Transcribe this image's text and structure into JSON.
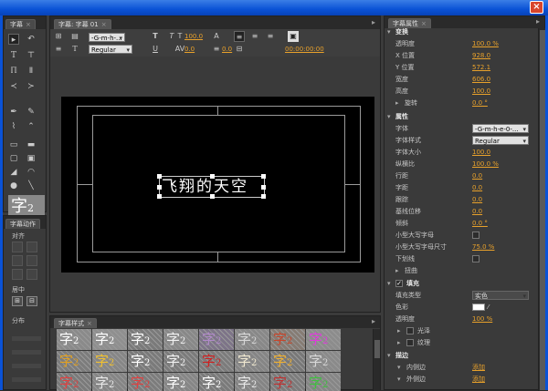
{
  "window": {
    "close_glyph": "×"
  },
  "tools_panel": {
    "tab": "字幕"
  },
  "align_panel": {
    "tab": "字幕动作",
    "align_label": "对齐",
    "center_label": "居中",
    "distribute_label": "分布"
  },
  "title_panel": {
    "tab": "字幕: 字幕 01",
    "font_select": "-G-m-h-...",
    "style_select": "Regular",
    "size_value": "100.0",
    "kerning_value": "0.0",
    "leading_value": "0.0",
    "timecode": "00:00:00:00",
    "canvas_text": "飞翔的天空"
  },
  "styles_panel": {
    "tab": "字幕样式",
    "swatch_glyph": "字",
    "swatch_suffix": "2",
    "swatches": [
      {
        "bg": "#8a8a8a",
        "fg": "#ffffff"
      },
      {
        "bg": "#8f8f8f",
        "fg": "#ffffff"
      },
      {
        "bg": "#7a7a7a",
        "fg": "#ffffff"
      },
      {
        "bg": "#888888",
        "fg": "#f2f2f2"
      },
      {
        "bg": "#7d7488",
        "fg": "#b08ac8"
      },
      {
        "bg": "#888888",
        "fg": "#d8d8d8"
      },
      {
        "bg": "#867c74",
        "fg": "#c8452a"
      },
      {
        "bg": "#8c8c8c",
        "fg": "#e03adc"
      },
      {
        "bg": "#7c7c7c",
        "fg": "#e2a020"
      },
      {
        "bg": "#868686",
        "fg": "#f0c030"
      },
      {
        "bg": "#7a7a7a",
        "fg": "#ffffff"
      },
      {
        "bg": "#7b7b7b",
        "fg": "#f2f2f2"
      },
      {
        "bg": "#7c7c7c",
        "fg": "#d02020"
      },
      {
        "bg": "#858585",
        "fg": "#f0e8d0"
      },
      {
        "bg": "#787878",
        "fg": "#f0b030"
      },
      {
        "bg": "#8a8a8a",
        "fg": "#d8d8d8"
      },
      {
        "bg": "#7a7a7a",
        "fg": "#e04040"
      },
      {
        "bg": "#858585",
        "fg": "#e8e8e8"
      },
      {
        "bg": "#7c7c7c",
        "fg": "#e04040"
      },
      {
        "bg": "#868686",
        "fg": "#ffffff"
      },
      {
        "bg": "#7a7a7a",
        "fg": "#ffffff"
      },
      {
        "bg": "#848484",
        "fg": "#e8e8e8"
      },
      {
        "bg": "#7c7c7c",
        "fg": "#c03030"
      },
      {
        "bg": "#868686",
        "fg": "#40c040"
      }
    ]
  },
  "properties_panel": {
    "tab": "字幕属性",
    "sections": {
      "transform": "变换",
      "properties": "属性",
      "fill": "填充",
      "stroke": "描边"
    },
    "rows": {
      "opacity": {
        "label": "透明度",
        "value": "100.0 %"
      },
      "x_pos": {
        "label": "X 位置",
        "value": "928.0"
      },
      "y_pos": {
        "label": "Y 位置",
        "value": "572.1"
      },
      "width": {
        "label": "宽度",
        "value": "606.0"
      },
      "height": {
        "label": "高度",
        "value": "100.0"
      },
      "rotation": {
        "label": "旋转",
        "value": "0.0 °"
      },
      "font": {
        "label": "字体",
        "value": "-G-m-h-e-0-..."
      },
      "font_style": {
        "label": "字体样式",
        "value": "Regular"
      },
      "font_size": {
        "label": "字体大小",
        "value": "100.0"
      },
      "aspect": {
        "label": "纵横比",
        "value": "100.0 %"
      },
      "leading": {
        "label": "行距",
        "value": "0.0"
      },
      "kerning": {
        "label": "字距",
        "value": "0.0"
      },
      "tracking": {
        "label": "跟踪",
        "value": "0.0"
      },
      "baseline": {
        "label": "基线位移",
        "value": "0.0"
      },
      "slant": {
        "label": "倾斜",
        "value": "0.0 °"
      },
      "small_caps": {
        "label": "小型大写字母"
      },
      "small_caps_size": {
        "label": "小型大写字母尺寸",
        "value": "75.0 %"
      },
      "underline": {
        "label": "下划线"
      },
      "distort": {
        "label": "扭曲"
      },
      "fill_type": {
        "label": "填充类型",
        "value": "实色"
      },
      "color": {
        "label": "色彩"
      },
      "fill_opacity": {
        "label": "透明度",
        "value": "100 %"
      },
      "sheen": {
        "label": "光泽"
      },
      "texture": {
        "label": "纹理"
      },
      "inner_stroke": {
        "label": "内侧边",
        "value": "添加"
      },
      "outer_stroke": {
        "label": "外侧边",
        "value": "添加"
      }
    }
  },
  "colors": {
    "accent": "#e8a12b",
    "titlebar": "#0a52d6"
  }
}
